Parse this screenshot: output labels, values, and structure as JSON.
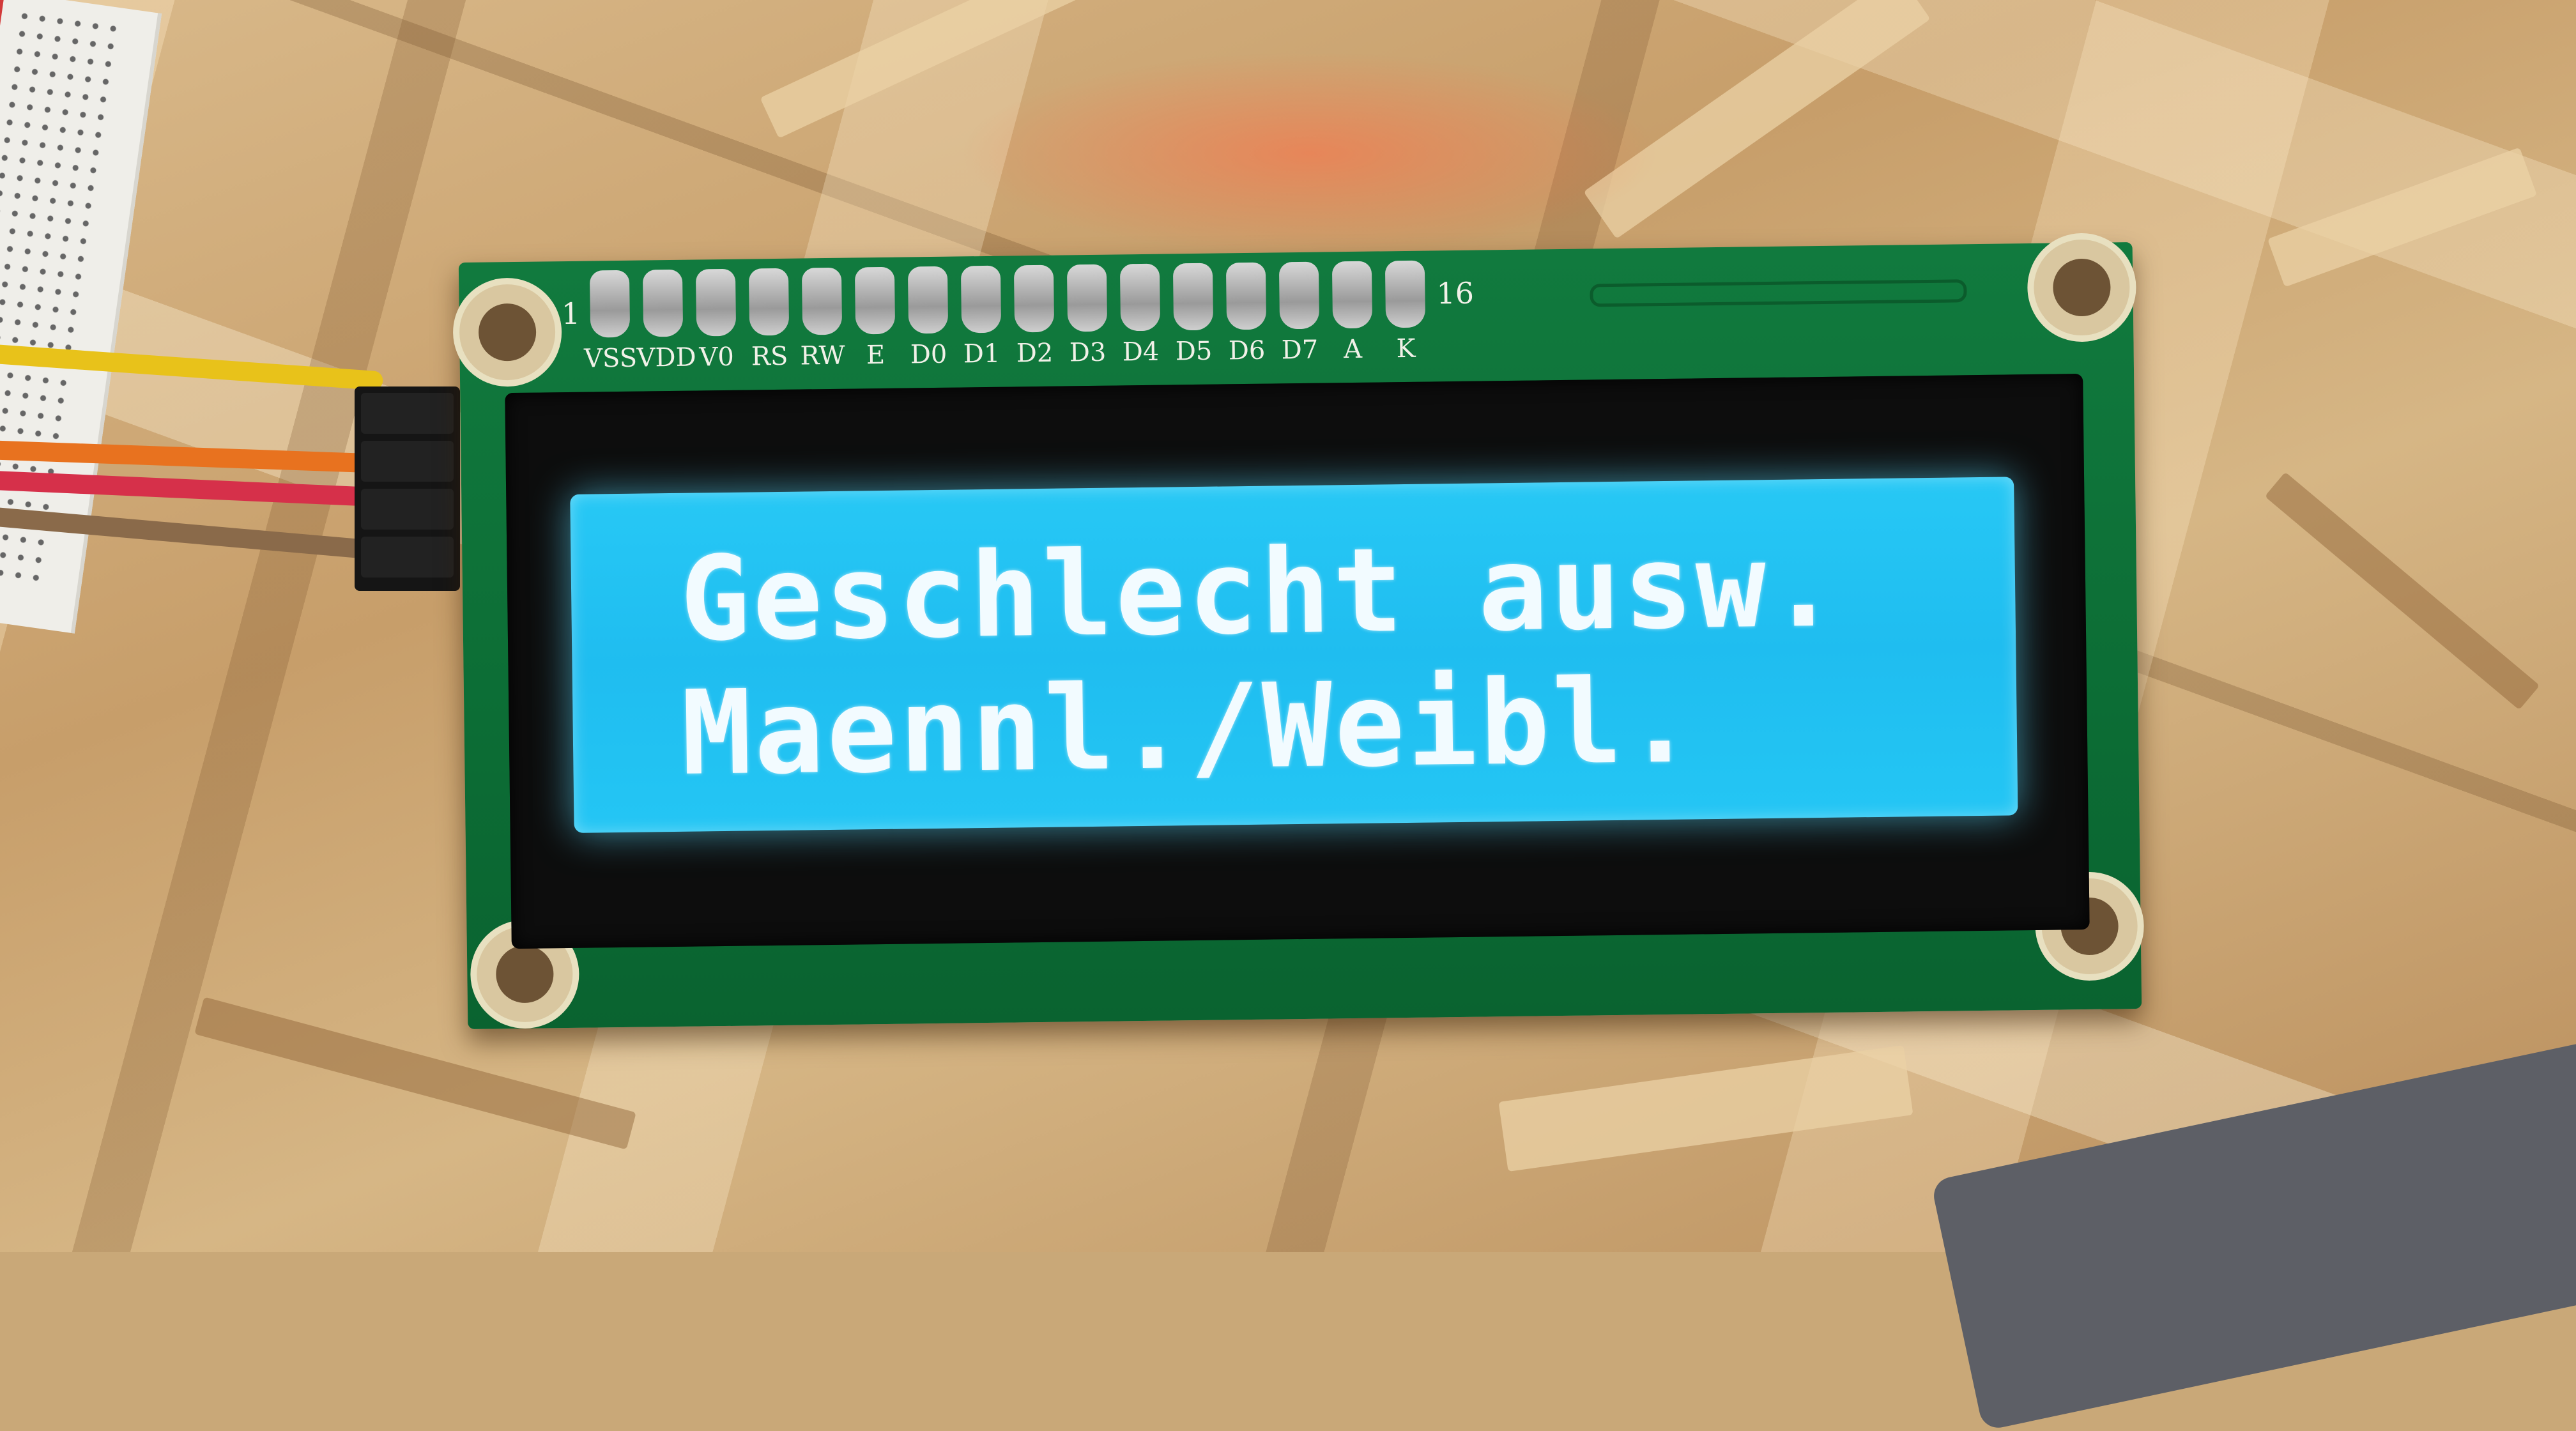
{
  "lcd": {
    "line1": "Geschlecht ausw.",
    "line2": "Maennl./Weibl."
  },
  "pcb": {
    "pin_first": "1",
    "pin_last": "16",
    "pin_labels": [
      "VSS",
      "VDD",
      "V0",
      "RS",
      "RW",
      "E",
      "D0",
      "D1",
      "D2",
      "D3",
      "D4",
      "D5",
      "D6",
      "D7",
      "A",
      "K"
    ]
  },
  "colors": {
    "lcd_backlight": "#1fbdf0",
    "lcd_text": "#f2fbff",
    "pcb_green": "#0c6d35",
    "bezel": "#0d0d0d"
  }
}
